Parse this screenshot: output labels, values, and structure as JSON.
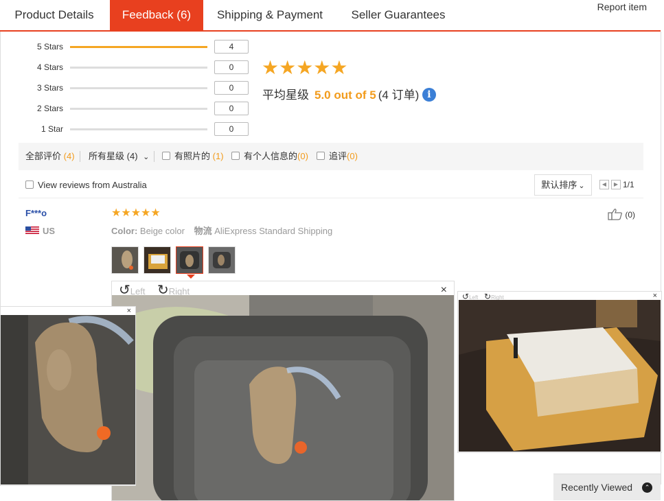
{
  "tabs": [
    {
      "label": "Product Details"
    },
    {
      "label": "Feedback (6)"
    },
    {
      "label": "Shipping & Payment"
    },
    {
      "label": "Seller Guarantees"
    }
  ],
  "report_item": "Report item",
  "ratings": [
    {
      "label": "5 Stars",
      "count": "4",
      "fraction": 1.0
    },
    {
      "label": "4 Stars",
      "count": "0",
      "fraction": 0.0
    },
    {
      "label": "3 Stars",
      "count": "0",
      "fraction": 0.0
    },
    {
      "label": "2 Stars",
      "count": "0",
      "fraction": 0.0
    },
    {
      "label": "1 Star",
      "count": "0",
      "fraction": 0.0
    }
  ],
  "summary": {
    "stars": "★★★★★",
    "avg_label": "平均星级",
    "score": "5.0 out of 5",
    "orders": "(4 订单)",
    "info_glyph": "i"
  },
  "filters": {
    "all": {
      "label": "全部评价",
      "count": "(4)"
    },
    "all_stars": {
      "label": "所有星级",
      "count": "(4)",
      "arrow": "⌄"
    },
    "with_photos": {
      "label": "有照片的",
      "count": "(1)"
    },
    "personal_info": {
      "label": "有个人信息的",
      "count": "(0)"
    },
    "follow_up": {
      "label": "追评",
      "count": "(0)"
    }
  },
  "view_australia": "View reviews from Australia",
  "sort": {
    "label": "默认排序",
    "arrow": "⌄"
  },
  "pagination": {
    "prev": "◀",
    "next": "▶",
    "text": "1/1"
  },
  "review": {
    "user": "F***o",
    "country": "US",
    "stars": "★★★★★",
    "color_label": "Color:",
    "color_value": "Beige color",
    "shipping_label": "物流",
    "shipping_value": "AliExpress Standard Shipping",
    "helpful_count": "(0)"
  },
  "viewer_main": {
    "rotate_left": "Left",
    "rotate_right": "Right",
    "close": "×"
  },
  "viewer_right": {
    "rotate_left": "Left",
    "rotate_right": "Right",
    "close": "×"
  },
  "viewer_left": {
    "close": "×"
  },
  "recently_viewed": {
    "label": "Recently Viewed",
    "icon": "⌃"
  },
  "colors": {
    "accent": "#e8401f",
    "star": "#f5a623",
    "score": "#f29b1b",
    "link": "#2a4fa8"
  }
}
